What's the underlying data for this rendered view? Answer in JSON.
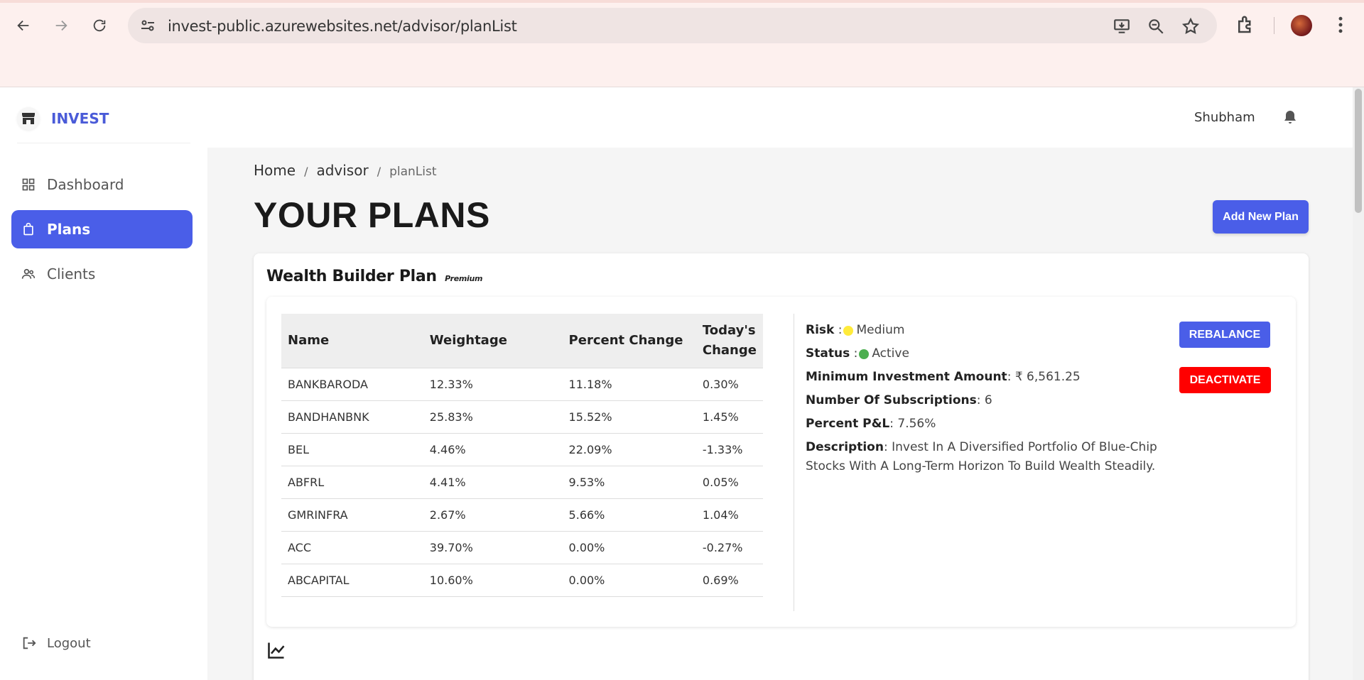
{
  "browser": {
    "url": "invest-public.azurewebsites.net/advisor/planList"
  },
  "sidebar": {
    "brand": "INVEST",
    "items": [
      {
        "label": "Dashboard",
        "icon": "grid-icon"
      },
      {
        "label": "Plans",
        "icon": "shopping-bag-icon",
        "active": true
      },
      {
        "label": "Clients",
        "icon": "users-icon"
      }
    ],
    "logout": "Logout"
  },
  "topbar": {
    "username": "Shubham"
  },
  "breadcrumb": {
    "home": "Home",
    "section": "advisor",
    "current": "planList"
  },
  "page": {
    "title": "YOUR PLANS",
    "add_button": "Add New Plan"
  },
  "plan": {
    "name": "Wealth Builder Plan",
    "tier": "Premium",
    "table": {
      "headers": [
        "Name",
        "Weightage",
        "Percent Change",
        "Today's Change"
      ],
      "rows": [
        {
          "name": "BANKBARODA",
          "weightage": "12.33%",
          "percent_change": "11.18%",
          "todays_change": "0.30%"
        },
        {
          "name": "BANDHANBNK",
          "weightage": "25.83%",
          "percent_change": "15.52%",
          "todays_change": "1.45%"
        },
        {
          "name": "BEL",
          "weightage": "4.46%",
          "percent_change": "22.09%",
          "todays_change": "-1.33%"
        },
        {
          "name": "ABFRL",
          "weightage": "4.41%",
          "percent_change": "9.53%",
          "todays_change": "0.05%"
        },
        {
          "name": "GMRINFRA",
          "weightage": "2.67%",
          "percent_change": "5.66%",
          "todays_change": "1.04%"
        },
        {
          "name": "ACC",
          "weightage": "39.70%",
          "percent_change": "0.00%",
          "todays_change": "-0.27%"
        },
        {
          "name": "ABCAPITAL",
          "weightage": "10.60%",
          "percent_change": "0.00%",
          "todays_change": "0.69%"
        }
      ]
    },
    "details": {
      "risk_label": "Risk",
      "risk_value": "Medium",
      "risk_color": "#ffeb3b",
      "status_label": "Status",
      "status_value": "Active",
      "status_color": "#4caf50",
      "min_investment_label": "Minimum Investment Amount",
      "min_investment_value": "₹ 6,561.25",
      "subscriptions_label": "Number Of Subscriptions",
      "subscriptions_value": "6",
      "pnl_label": "Percent P&L",
      "pnl_value": "7.56%",
      "description_label": "Description",
      "description_value": "Invest In A Diversified Portfolio Of Blue-Chip Stocks With A Long-Term Horizon To Build Wealth Steadily."
    },
    "actions": {
      "rebalance": "REBALANCE",
      "deactivate": "DEACTIVATE"
    }
  },
  "colors": {
    "accent": "#4a5ee8",
    "danger": "#ff0000",
    "positive": "#2e7d32",
    "negative": "#d32f2f"
  }
}
